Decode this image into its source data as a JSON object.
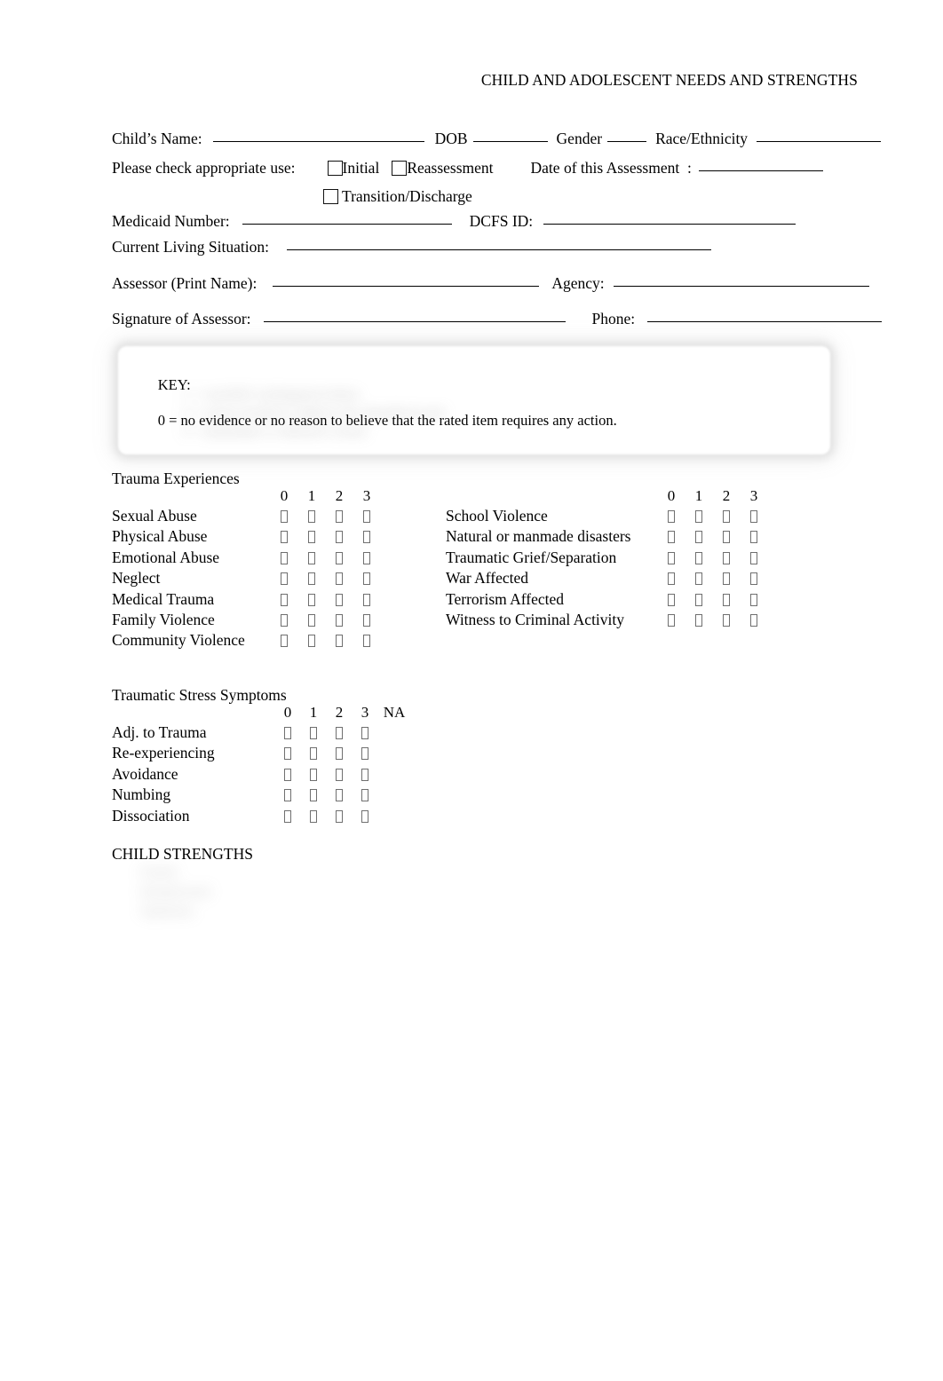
{
  "document": {
    "title": "CHILD AND ADOLESCENT NEEDS AND STRENGTHS"
  },
  "identity": {
    "child_name_label": "Child’s Name:",
    "dob_label": "DOB",
    "gender_label": "Gender",
    "race_label": "Race/Ethnicity",
    "child_name_value": "",
    "dob_value": "",
    "gender_value": "",
    "race_value": ""
  },
  "use_type": {
    "prompt": "Please check appropriate use:",
    "options": [
      {
        "label": "Initial",
        "checked": false
      },
      {
        "label": "Reassessment",
        "checked": false
      },
      {
        "label": "Transition/Discharge",
        "checked": false
      }
    ],
    "date_label": "Date of this Assessment  :",
    "date_value": ""
  },
  "ids": {
    "medicaid_label": "Medicaid Number:",
    "medicaid_value": "",
    "dcfs_label": "DCFS ID:",
    "dcfs_value": "",
    "living_label": "Current Living Situation:",
    "living_value": ""
  },
  "assessor": {
    "name_label": "Assessor (Print Name):",
    "name_value": "",
    "agency_label": "Agency:",
    "agency_value": "",
    "signature_label": "Signature of Assessor:",
    "signature_value": "",
    "phone_label": "Phone:",
    "phone_value": ""
  },
  "key_box": {
    "heading": "KEY:",
    "line": "0 = no evidence or no reason to believe that the rated item requires any action.",
    "redacted_lines": [
      "1 = watchful waiting/prevention",
      "2 = action needed to address the identified need",
      "3 = immediate or intensive action"
    ],
    "redacted": true
  },
  "trauma_experiences": {
    "title": "Trauma Experiences",
    "scale": [
      "0",
      "1",
      "2",
      "3"
    ],
    "left_items": [
      "Sexual Abuse",
      "Physical Abuse",
      "Emotional Abuse",
      "Neglect",
      "Medical Trauma",
      "Family Violence",
      "Community Violence"
    ],
    "right_items": [
      "School Violence",
      "Natural or manmade disasters",
      "Traumatic Grief/Separation",
      "War Affected",
      "Terrorism Affected",
      "Witness to Criminal Activity"
    ]
  },
  "traumatic_stress": {
    "title": "Traumatic Stress Symptoms",
    "scale": [
      "0",
      "1",
      "2",
      "3",
      "NA"
    ],
    "rating_columns": 4,
    "items": [
      "Adj. to Trauma",
      "Re-experiencing",
      "Avoidance",
      "Numbing",
      "Dissociation"
    ]
  },
  "child_strengths": {
    "title": "CHILD STRENGTHS",
    "redacted": true,
    "redacted_lines": [
      "Family",
      "Interpersonal",
      "Optimism"
    ]
  }
}
